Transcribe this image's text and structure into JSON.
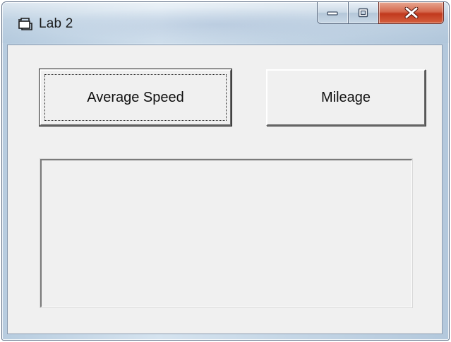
{
  "window": {
    "title": "Lab 2",
    "icon": "form-icon"
  },
  "caption_buttons": {
    "minimize_icon": "minimize-icon",
    "maximize_icon": "maximize-icon",
    "close_icon": "close-icon"
  },
  "buttons": {
    "average_speed_label": "Average Speed",
    "mileage_label": "Mileage"
  },
  "output": {
    "text": ""
  },
  "colors": {
    "form_background": "#f0f0f0",
    "close_button": "#c1391d",
    "titlebar": "#c7d8e7"
  }
}
